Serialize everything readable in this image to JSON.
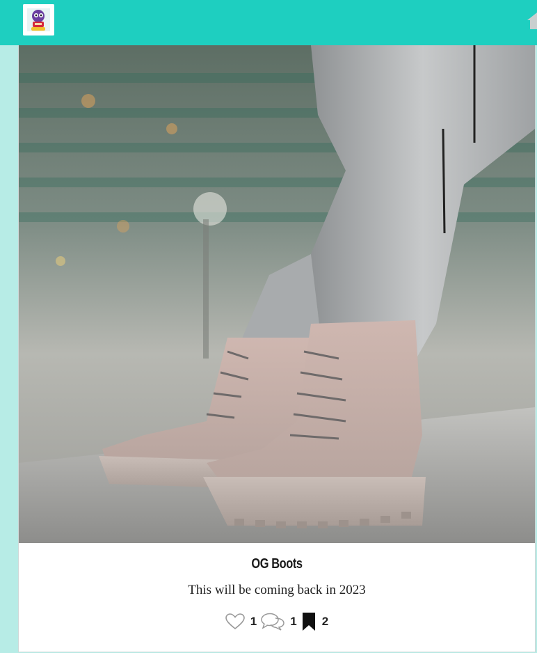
{
  "header": {
    "logo_icon": "sneaker-mascot-logo",
    "home_icon": "home-icon",
    "background_color": "#1ecfc0"
  },
  "post": {
    "image_alt": "Pair of beige lace-up boots worn with grey ripped jeans on a city street",
    "title": "OG Boots",
    "description": "This will be coming back in 2023",
    "likes": "1",
    "comments": "1",
    "saves": "2"
  },
  "icons": {
    "like": "heart-outline-icon",
    "comment": "speech-bubbles-icon",
    "save": "bookmark-filled-icon"
  }
}
